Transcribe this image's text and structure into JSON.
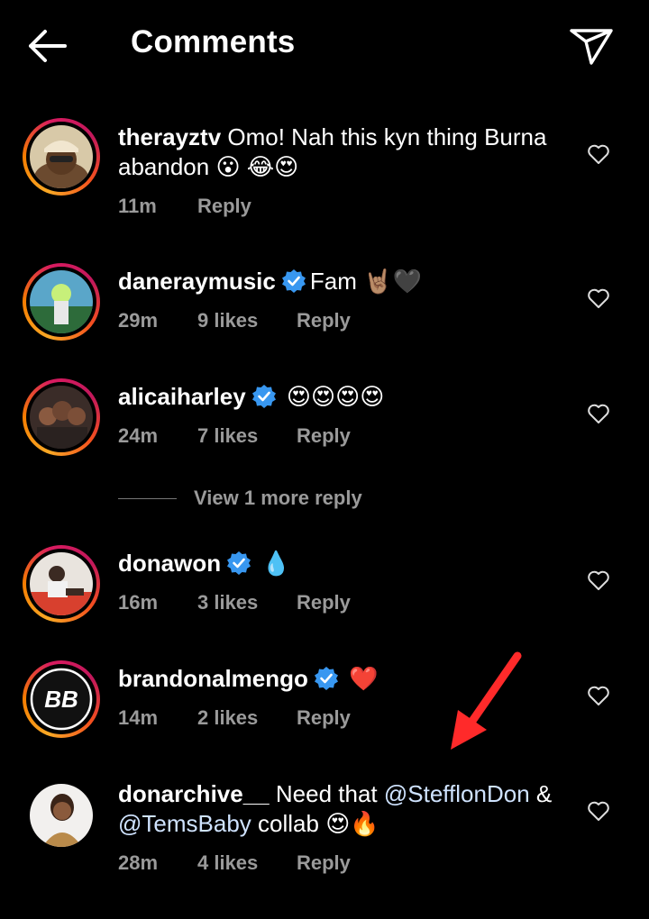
{
  "header": {
    "title": "Comments",
    "back_icon": "arrow-left-icon",
    "send_icon": "paper-plane-icon"
  },
  "comments": [
    {
      "username": "therayztv",
      "text_line1": "Omo! Nah this kyn thing Burna",
      "text_line2": "abandon",
      "emojis": "😮 😂😍",
      "time": "11m",
      "likes": "",
      "reply": "Reply"
    },
    {
      "username": "daneraymusic",
      "verified": true,
      "text": "Fam",
      "emojis": "🤘🏽🖤",
      "time": "29m",
      "likes": "9 likes",
      "reply": "Reply"
    },
    {
      "username": "alicaiharley",
      "verified": true,
      "text": "",
      "emojis": "😍😍😍😍",
      "time": "24m",
      "likes": "7 likes",
      "reply": "Reply"
    },
    {
      "username": "donawon",
      "verified": true,
      "text": "",
      "emojis": "💧",
      "time": "16m",
      "likes": "3 likes",
      "reply": "Reply"
    },
    {
      "username": "brandonalmengo",
      "verified": true,
      "text": "",
      "emojis": "❤️",
      "time": "14m",
      "likes": "2 likes",
      "reply": "Reply"
    },
    {
      "username": "donarchive__",
      "text_line1": "Need that",
      "mention1": "@StefflonDon",
      "amp": "&",
      "mention2": "@TemsBaby",
      "text_line2": "collab",
      "emojis": "😍🔥",
      "time": "28m",
      "likes": "4 likes",
      "reply": "Reply"
    }
  ],
  "more_replies": "View 1 more reply",
  "colors": {
    "background": "#000000",
    "text": "#ffffff",
    "meta": "#9a9a9a",
    "verified": "#3897f0",
    "annotation_arrow": "#ff2a2a"
  }
}
